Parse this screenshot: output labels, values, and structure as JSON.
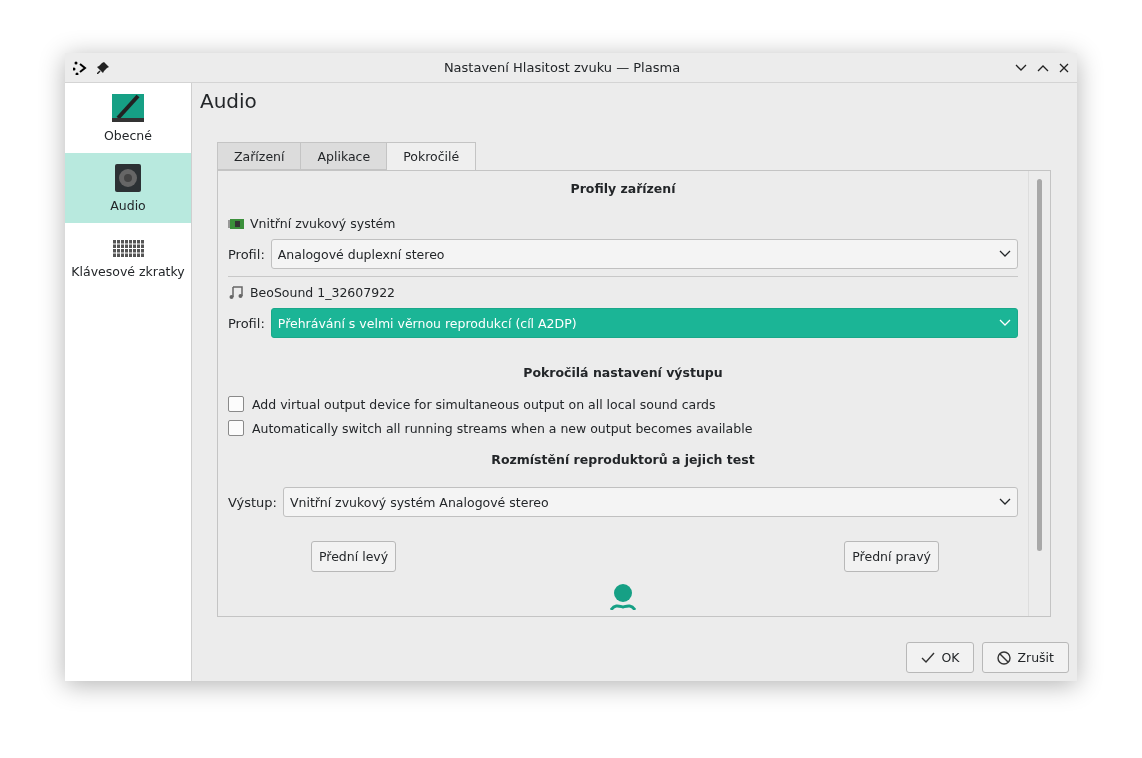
{
  "window": {
    "title": "Nastavení Hlasitost zvuku — Plasma"
  },
  "sidebar": {
    "items": [
      {
        "label": "Obecné",
        "kind": "general",
        "selected": false
      },
      {
        "label": "Audio",
        "kind": "speaker",
        "selected": true
      },
      {
        "label": "Klávesové zkratky",
        "kind": "keyboard",
        "selected": false
      }
    ]
  },
  "page_title": "Audio",
  "tabs": [
    {
      "label": "Zařízení",
      "selected": false
    },
    {
      "label": "Aplikace",
      "selected": false
    },
    {
      "label": "Pokročilé",
      "selected": true
    }
  ],
  "profiles": {
    "heading": "Profily zařízení",
    "devices": [
      {
        "name": "Vnitřní zvukový systém",
        "kind": "card",
        "label": "Profil:",
        "value": "Analogové duplexní stereo",
        "highlighted": false
      },
      {
        "name": "BeoSound 1_32607922",
        "kind": "music",
        "label": "Profil:",
        "value": "Přehrávání s velmi věrnou reprodukcí (cíl A2DP)",
        "highlighted": true
      }
    ]
  },
  "output_settings": {
    "heading": "Pokročilá nastavení výstupu",
    "options": [
      {
        "label": "Add virtual output device for simultaneous output on all local sound cards",
        "checked": false
      },
      {
        "label": "Automatically switch all running streams when a new output becomes available",
        "checked": false
      }
    ]
  },
  "speaker_test": {
    "heading": "Rozmístění reproduktorů a jejich test",
    "label": "Výstup:",
    "value": "Vnitřní zvukový systém Analogové stereo",
    "buttons": [
      "Přední levý",
      "Přední pravý"
    ]
  },
  "buttons": [
    {
      "label": "OK",
      "kind": "ok"
    },
    {
      "label": "Zrušit",
      "kind": "cancel"
    }
  ]
}
